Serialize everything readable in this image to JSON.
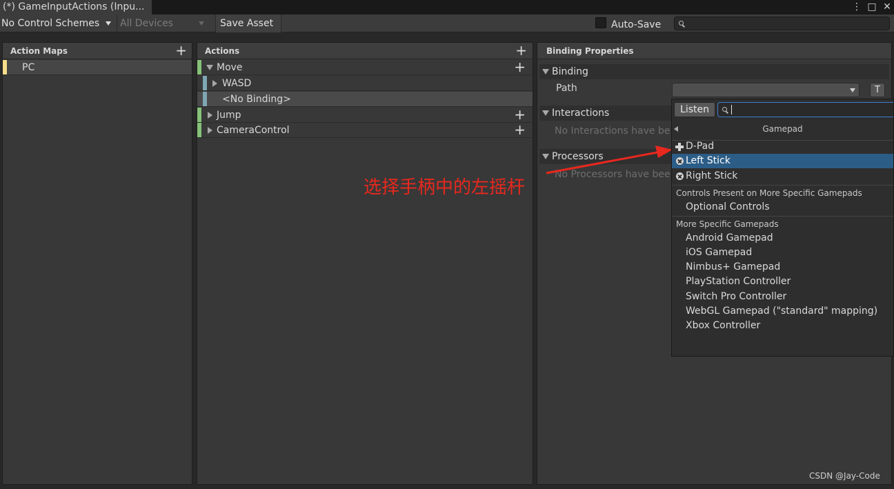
{
  "window": {
    "tab_title": "(*) GameInputActions (Inpu...",
    "menu_glyph": "⋮",
    "maximize_glyph": "□",
    "close_glyph": "✕"
  },
  "toolbar": {
    "control_schemes": "No Control Schemes",
    "devices": "All Devices",
    "save_asset": "Save Asset",
    "auto_save": "Auto-Save",
    "search_value": ""
  },
  "action_maps": {
    "header": "Action Maps",
    "add_glyph": "+",
    "items": [
      {
        "label": "PC",
        "color": "#f7dc8a"
      }
    ]
  },
  "actions": {
    "header": "Actions",
    "add_glyph": "+",
    "items": [
      {
        "label": "Move",
        "kind": "action",
        "color": "#86c17a"
      },
      {
        "label": "WASD",
        "kind": "composite",
        "color": "#7fa7b3"
      },
      {
        "label": "<No Binding>",
        "kind": "binding",
        "color": "#7fa7b3"
      },
      {
        "label": "Jump",
        "kind": "action",
        "color": "#86c17a"
      },
      {
        "label": "CameraControl",
        "kind": "action",
        "color": "#86c17a"
      }
    ]
  },
  "binding_properties": {
    "header": "Binding Properties",
    "binding_section": "Binding",
    "path_label": "Path",
    "path_value": "",
    "t_button": "T",
    "interactions_section": "Interactions",
    "interactions_note": "No Interactions have be",
    "processors_section": "Processors",
    "processors_note": "No Processors have bee"
  },
  "popup": {
    "listen_button": "Listen",
    "search_value": "",
    "breadcrumb": "Gamepad",
    "gamepad_items": [
      {
        "label": "D-Pad",
        "icon": "dpad-icon",
        "selected": false
      },
      {
        "label": "Left Stick",
        "icon": "stick-icon",
        "selected": true
      },
      {
        "label": "Right Stick",
        "icon": "stick-icon",
        "selected": false
      }
    ],
    "category_1": "Controls Present on More Specific Gamepads",
    "category_1_items": [
      "Optional Controls"
    ],
    "category_2": "More Specific Gamepads",
    "category_2_items": [
      "Android Gamepad",
      "iOS Gamepad",
      "Nimbus+ Gamepad",
      "PlayStation Controller",
      "Switch Pro Controller",
      "WebGL Gamepad (\"standard\" mapping)",
      "Xbox Controller"
    ]
  },
  "annotation": {
    "text": "选择手柄中的左摇杆",
    "color": "#e8281e"
  },
  "watermark": "CSDN @Jay-Code"
}
